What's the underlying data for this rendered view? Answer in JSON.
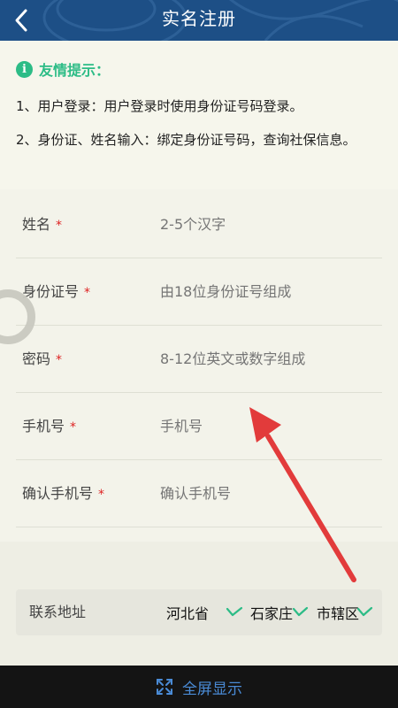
{
  "header": {
    "title": "实名注册"
  },
  "tips": {
    "title": "友情提示：",
    "items": [
      "1、用户登录：用户登录时使用身份证号码登录。",
      "2、身份证、姓名输入：绑定身份证号码，查询社保信息。"
    ]
  },
  "form": {
    "required_mark": "*",
    "fields": [
      {
        "label": "姓名",
        "placeholder": "2-5个汉字"
      },
      {
        "label": "身份证号",
        "placeholder": "由18位身份证号组成"
      },
      {
        "label": "密码",
        "placeholder": "8-12位英文或数字组成"
      },
      {
        "label": "手机号",
        "placeholder": "手机号"
      },
      {
        "label": "确认手机号",
        "placeholder": "确认手机号"
      }
    ]
  },
  "address": {
    "label": "联系地址",
    "province": "河北省",
    "city": "石家庄",
    "district": "市辖区"
  },
  "bottom": {
    "fullscreen_label": "全屏显示"
  },
  "colors": {
    "header": "#1d4f86",
    "accent": "#2cbc86",
    "arrow": "#e23b3b",
    "required": "#dd2222"
  }
}
